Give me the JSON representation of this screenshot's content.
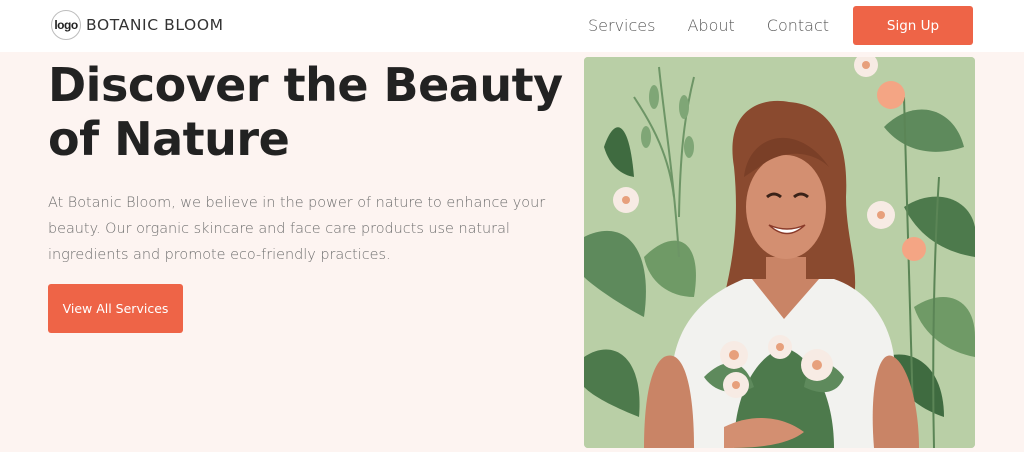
{
  "header": {
    "logo_text": "logo",
    "brand_name": "BOTANIC BLOOM",
    "nav": [
      {
        "label": "Services"
      },
      {
        "label": "About"
      },
      {
        "label": "Contact"
      }
    ],
    "signup_label": "Sign Up"
  },
  "hero": {
    "title": "Discover the Beauty of Nature",
    "description": "At Botanic Bloom, we believe in the power of nature to enhance your beauty. Our organic skincare and face care products use natural ingredients and promote eco-friendly practices.",
    "cta_label": "View All Services"
  },
  "colors": {
    "accent": "#ee6447",
    "hero_background": "#fdf4f1",
    "illustration_background": "#b9cfa6"
  }
}
